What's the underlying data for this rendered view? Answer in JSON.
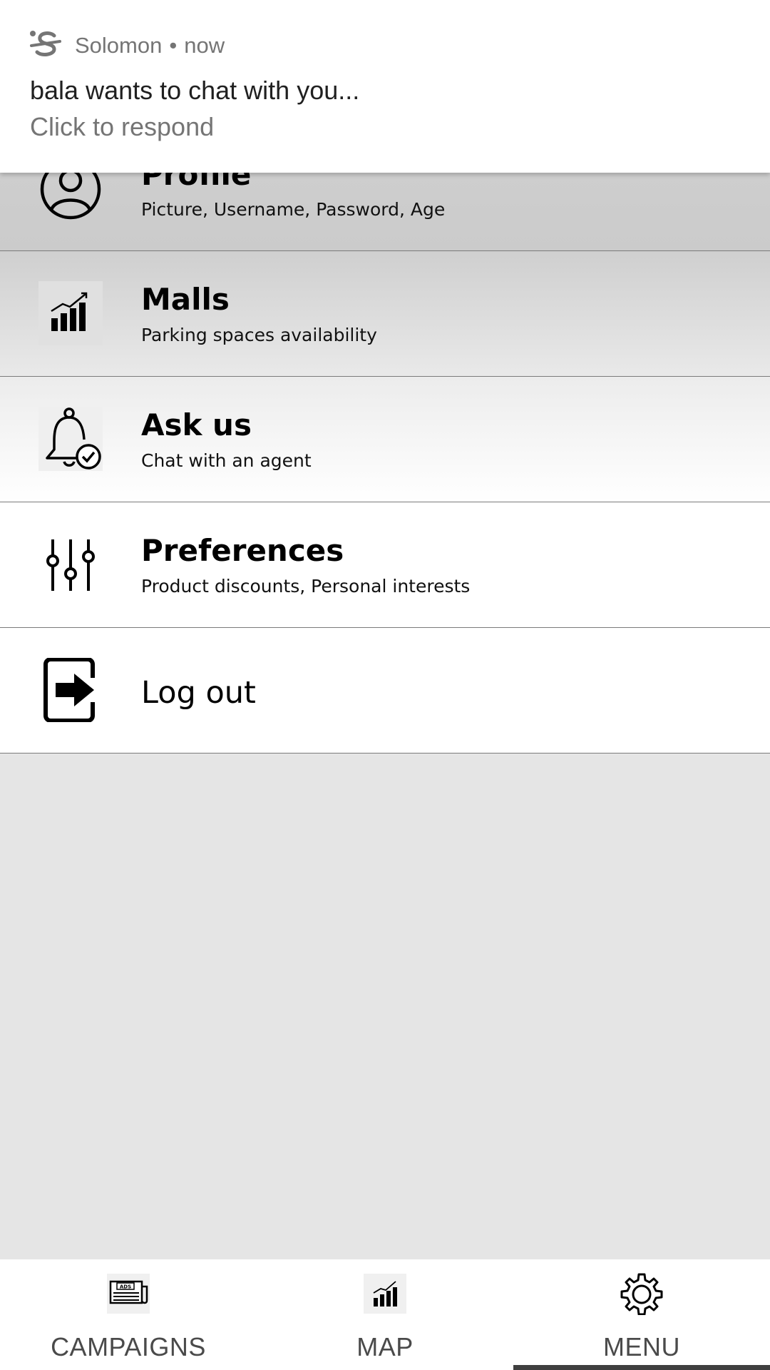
{
  "notification": {
    "app_name": "Solomon",
    "separator": "•",
    "time": "now",
    "title": "bala wants to chat with you...",
    "body": "Click to respond",
    "icon": "solomon-app-icon"
  },
  "menu": {
    "items": [
      {
        "icon": "user-circle-icon",
        "title": "Profile",
        "subtitle": "Picture, Username, Password, Age"
      },
      {
        "icon": "bar-chart-icon",
        "title": "Malls",
        "subtitle": "Parking spaces availability"
      },
      {
        "icon": "bell-check-icon",
        "title": "Ask us",
        "subtitle": "Chat with an agent"
      },
      {
        "icon": "sliders-icon",
        "title": "Preferences",
        "subtitle": "Product discounts, Personal interests"
      },
      {
        "icon": "logout-icon",
        "title": "Log out"
      }
    ]
  },
  "bottom_nav": {
    "active": "MENU",
    "tabs": [
      {
        "label": "CAMPAIGNS",
        "icon": "ads-newspaper-icon"
      },
      {
        "label": "MAP",
        "icon": "bar-chart-icon"
      },
      {
        "label": "MENU",
        "icon": "gear-icon"
      }
    ]
  }
}
